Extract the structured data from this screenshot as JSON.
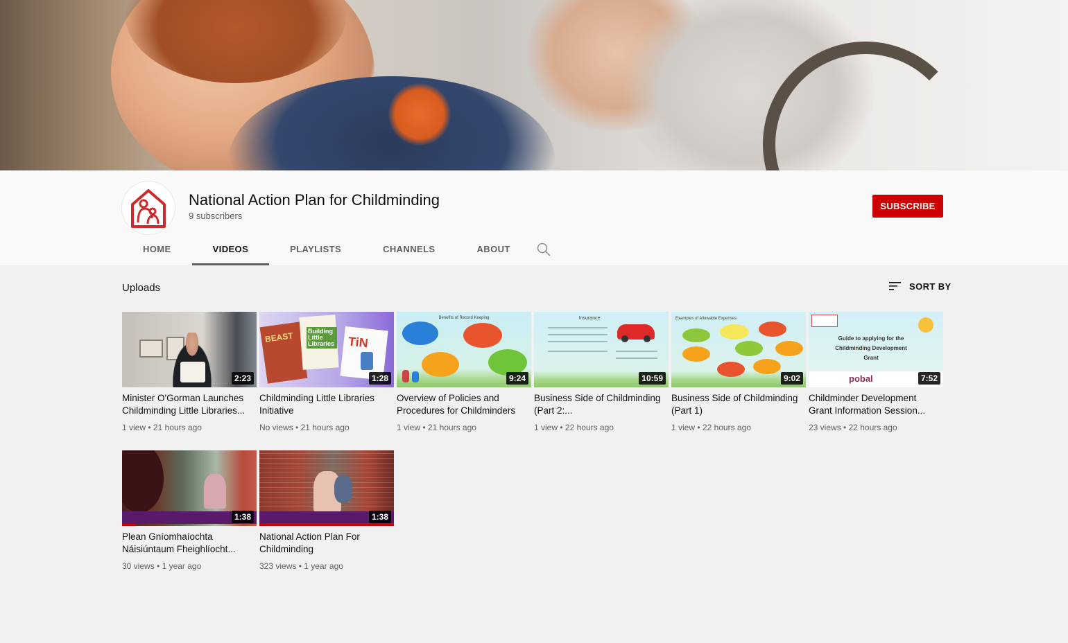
{
  "channel": {
    "name": "National Action Plan for Childminding",
    "subscribers": "9 subscribers",
    "subscribe_label": "SUBSCRIBE"
  },
  "tabs": [
    {
      "label": "HOME"
    },
    {
      "label": "VIDEOS"
    },
    {
      "label": "PLAYLISTS"
    },
    {
      "label": "CHANNELS"
    },
    {
      "label": "ABOUT"
    }
  ],
  "section": {
    "title": "Uploads",
    "sort_label": "SORT BY"
  },
  "videos": [
    {
      "title": "Minister O'Gorman Launches Childminding Little Libraries...",
      "duration": "2:23",
      "views": "1 view",
      "age": "21 hours ago"
    },
    {
      "title": "Childminding Little Libraries Initiative",
      "duration": "1:28",
      "views": "No views",
      "age": "21 hours ago"
    },
    {
      "title": "Overview of Policies and Procedures for Childminders",
      "duration": "9:24",
      "views": "1 view",
      "age": "21 hours ago"
    },
    {
      "title": "Business Side of Childminding (Part 2:...",
      "duration": "10:59",
      "views": "1 view",
      "age": "22 hours ago"
    },
    {
      "title": "Business Side of Childminding (Part 1)",
      "duration": "9:02",
      "views": "1 view",
      "age": "22 hours ago"
    },
    {
      "title": "Childminder Development Grant Information Session...",
      "duration": "7:52",
      "views": "23 views",
      "age": "22 hours ago"
    },
    {
      "title": "Plean Gníomhaíochta Náisiúntaum Fheighlíocht...",
      "duration": "1:38",
      "views": "30 views",
      "age": "1 year ago"
    },
    {
      "title": "National Action Plan For Childminding",
      "duration": "1:38",
      "views": "323 views",
      "age": "1 year ago"
    }
  ],
  "thumb_text": {
    "t2_beast": "BEAST",
    "t2_book": "Building Little Libraries",
    "t2_tin": "TiN",
    "t3_heading": "Benefits of Record Keeping",
    "t4_heading": "Insurance",
    "t5_heading": "Examples of Allowable Expenses",
    "t6_heading": "Guide to applying for the Childminding Development Grant",
    "t6_logo": "pobal"
  },
  "colors": {
    "accent": "#cc0000",
    "meta_text": "#606060"
  },
  "icons": {
    "search": "search-icon",
    "sort": "sort-icon",
    "avatar": "house-family-icon"
  }
}
